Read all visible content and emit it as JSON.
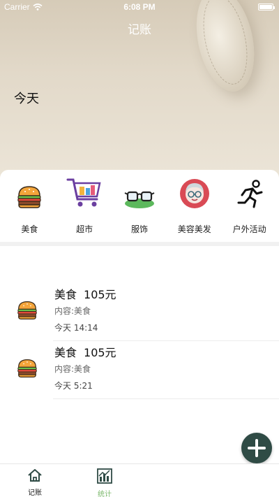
{
  "status_bar": {
    "carrier": "Carrier",
    "time": "6:08 PM"
  },
  "header": {
    "title": "记账"
  },
  "categories": [
    {
      "label": "美食",
      "icon": "burger-icon"
    },
    {
      "label": "超市",
      "icon": "shopping-cart-icon"
    },
    {
      "label": "服饰",
      "icon": "glasses-icon"
    },
    {
      "label": "美容美发",
      "icon": "beauty-face-icon"
    },
    {
      "label": "户外活动",
      "icon": "running-person-icon"
    }
  ],
  "records": {
    "section_title": "今天",
    "items": [
      {
        "category": "美食",
        "amount": "105元",
        "content": "内容:美食",
        "time": "今天 14:14",
        "icon": "burger-icon"
      },
      {
        "category": "美食",
        "amount": "105元",
        "content": "内容:美食",
        "time": "今天 5:21",
        "icon": "burger-icon"
      }
    ]
  },
  "fab": {
    "icon": "plus-icon"
  },
  "tabbar": {
    "tabs": [
      {
        "label": "记账",
        "icon": "home-icon",
        "active": true
      },
      {
        "label": "统计",
        "icon": "chart-icon",
        "active": false
      }
    ]
  },
  "colors": {
    "accent_dark": "#2f4b45",
    "tab_inactive": "#7ab86a"
  }
}
